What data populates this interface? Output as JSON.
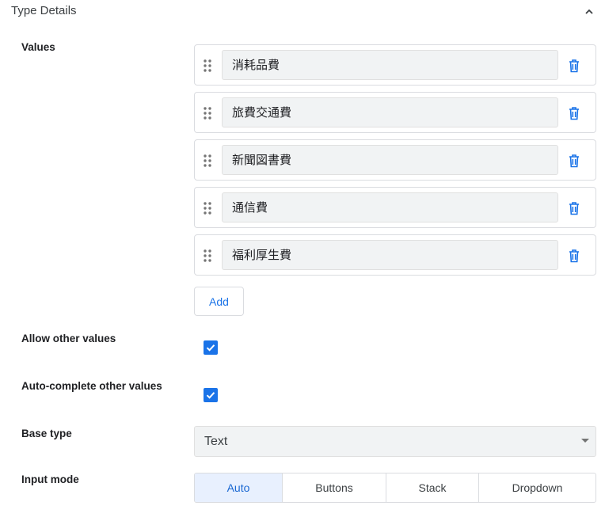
{
  "header": {
    "title": "Type Details",
    "collapse_icon": "chevron-up-icon"
  },
  "labels": {
    "values": "Values",
    "allow_other": "Allow other values",
    "autocomplete_other": "Auto-complete other values",
    "base_type": "Base type",
    "input_mode": "Input mode"
  },
  "values": [
    {
      "text": "消耗品費"
    },
    {
      "text": "旅費交通費"
    },
    {
      "text": "新聞図書費"
    },
    {
      "text": "通信費"
    },
    {
      "text": "福利厚生費"
    }
  ],
  "add_label": "Add",
  "allow_other_checked": true,
  "autocomplete_other_checked": true,
  "base_type": {
    "selected": "Text"
  },
  "input_mode": {
    "options": [
      "Auto",
      "Buttons",
      "Stack",
      "Dropdown"
    ],
    "selected": "Auto"
  },
  "colors": {
    "accent": "#1a73e8",
    "field_bg": "#f1f3f4",
    "border": "#dadce0",
    "active_bg": "#e8f0fe"
  }
}
